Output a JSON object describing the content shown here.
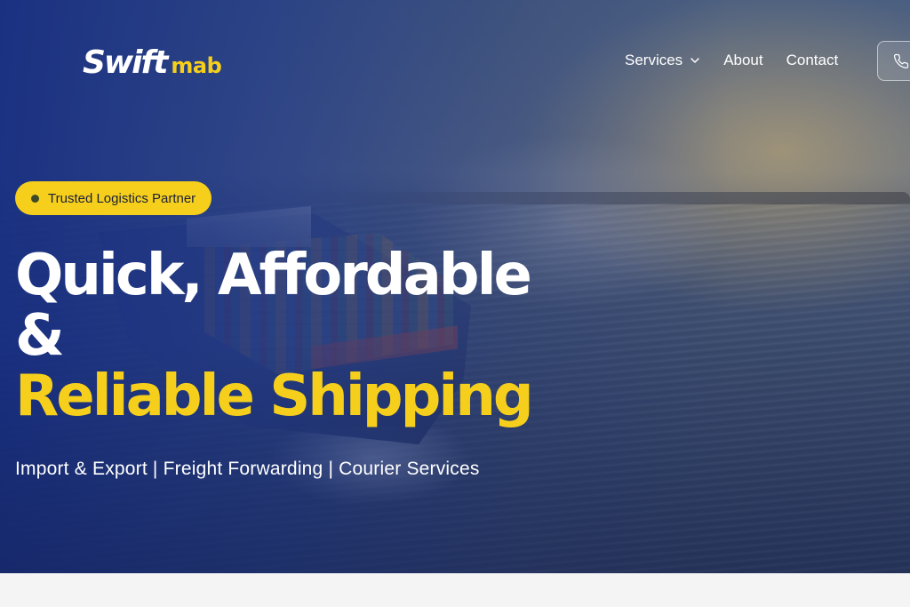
{
  "brand": {
    "name_main": "Swift",
    "name_sub": "mab"
  },
  "nav": {
    "items": [
      {
        "label": "Services",
        "has_dropdown": true
      },
      {
        "label": "About"
      },
      {
        "label": "Contact"
      }
    ],
    "phone_icon": "phone-icon"
  },
  "hero": {
    "badge": "Trusted Logistics Partner",
    "headline_line1": "Quick, Affordable",
    "headline_line2": "&",
    "headline_line3": "Reliable Shipping",
    "subtitle": "Import & Export | Freight Forwarding | Courier Services"
  },
  "colors": {
    "accent": "#f5cf1b",
    "primary": "#1f3a8a",
    "text_light": "#ffffff"
  }
}
